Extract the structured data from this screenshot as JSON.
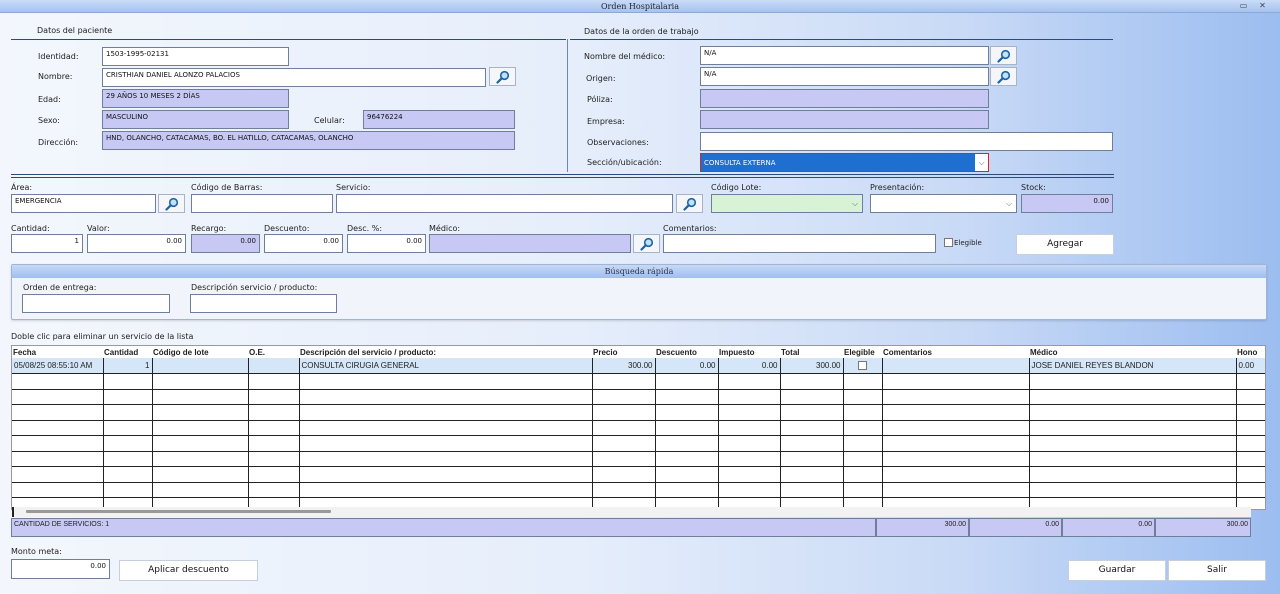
{
  "window": {
    "title": "Orden Hospitalaria"
  },
  "paciente": {
    "section_title": "Datos del paciente",
    "identidad_label": "Identidad:",
    "identidad": "1503-1995-02131",
    "nombre_label": "Nombre:",
    "nombre": "CRISTHIAN DANIEL ALONZO PALACIOS",
    "edad_label": "Edad:",
    "edad": "29 AÑOS 10 MESES 2 DÍAS",
    "sexo_label": "Sexo:",
    "sexo": "MASCULINO",
    "celular_label": "Celular:",
    "celular": "96476224",
    "direccion_label": "Dirección:",
    "direccion": "HND, OLANCHO, CATACAMAS, BO. EL HATILLO, CATACAMAS, OLANCHO"
  },
  "orden": {
    "section_title": "Datos de la orden de trabajo",
    "medico_label": "Nombre del médico:",
    "medico": "N/A",
    "origen_label": "Origen:",
    "origen": "N/A",
    "poliza_label": "Póliza:",
    "poliza": "",
    "empresa_label": "Empresa:",
    "empresa": "",
    "observaciones_label": "Observaciones:",
    "observaciones": "",
    "seccion_label": "Sección/ubicación:",
    "seccion": "CONSULTA EXTERNA"
  },
  "servicio": {
    "area_label": "Área:",
    "area": "EMERGENCIA",
    "codigo_barras_label": "Código de Barras:",
    "codigo_barras": "",
    "servicio_label": "Servicio:",
    "servicio": "",
    "codigo_lote_label": "Código Lote:",
    "codigo_lote": "",
    "presentacion_label": "Presentación:",
    "presentacion": "",
    "stock_label": "Stock:",
    "stock": "0.00",
    "cantidad_label": "Cantidad:",
    "cantidad": "1",
    "valor_label": "Valor:",
    "valor": "0.00",
    "recargo_label": "Recargo:",
    "recargo": "0.00",
    "descuento_label": "Descuento:",
    "descuento": "0.00",
    "desc_pct_label": "Desc. %:",
    "desc_pct": "0.00",
    "medico_label": "Médico:",
    "medico": "",
    "comentarios_label": "Comentarios:",
    "comentarios": "",
    "elegible_label": "Elegible",
    "agregar_label": "Agregar"
  },
  "busqueda": {
    "title": "Búsqueda rápida",
    "orden_entrega_label": "Orden de entrega:",
    "orden_entrega": "",
    "descripcion_label": "Descripción servicio / producto:",
    "descripcion": ""
  },
  "grid": {
    "hint": "Doble clic para eliminar un servicio de la lista",
    "headers": [
      "Fecha",
      "Cantidad",
      "Código de lote",
      "O.E.",
      "Descripción del servicio / producto:",
      "Precio",
      "Descuento",
      "Impuesto",
      "Total",
      "Elegible",
      "Comentarios",
      "Médico",
      "Hono"
    ],
    "rows": [
      [
        "05/08/25 08:55:10 AM",
        "1",
        "",
        "",
        "CONSULTA CIRUGIA GENERAL",
        "300.00",
        "0.00",
        "0.00",
        "300.00",
        "",
        "",
        "JOSE DANIEL REYES BLANDON",
        "0.00"
      ]
    ]
  },
  "totales": {
    "cantidad_servicios": "CANTIDAD DE SERVICIOS: 1",
    "valores": [
      "300.00",
      "0.00",
      "0.00",
      "300.00"
    ]
  },
  "monto": {
    "label": "Monto meta:",
    "value": "0.00"
  },
  "buttons": {
    "aplicar_descuento": "Aplicar descuento",
    "guardar": "Guardar",
    "salir": "Salir"
  }
}
